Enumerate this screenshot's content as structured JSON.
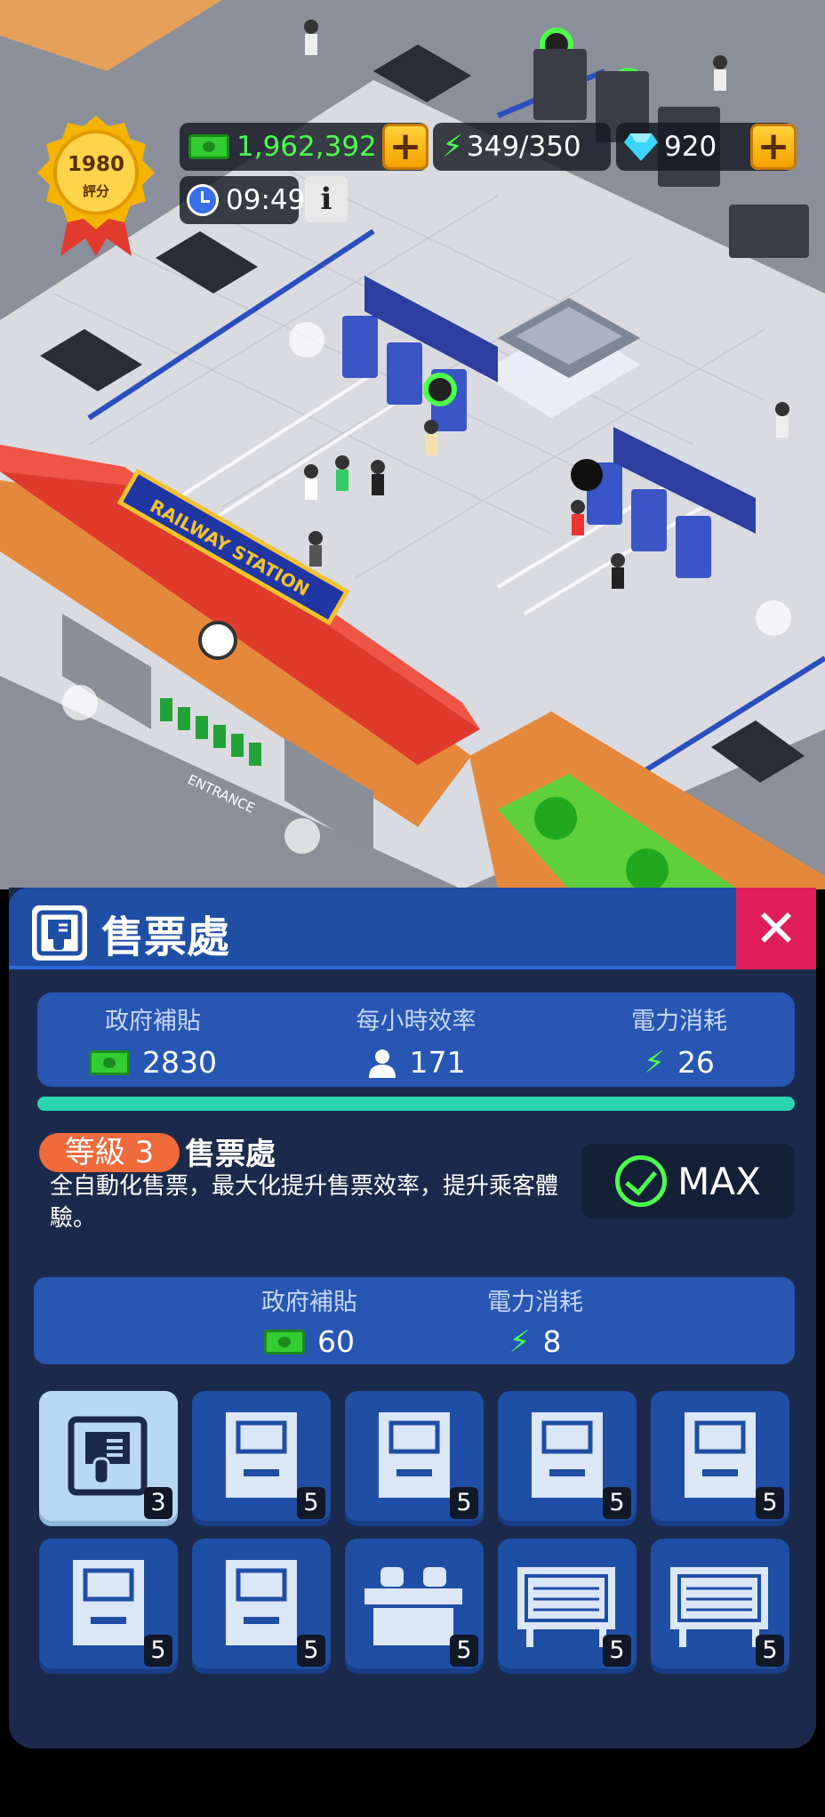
{
  "hud": {
    "rating": {
      "value": "1980",
      "label": "評分"
    },
    "money": {
      "value": "1,962,392",
      "icon": "cash-icon"
    },
    "energy": {
      "value": "349/350",
      "icon": "lightning-icon"
    },
    "gems": {
      "value": "920",
      "icon": "diamond-icon"
    },
    "time": {
      "value": "09:49",
      "icon": "clock-icon"
    },
    "info_button": "i",
    "plus_button": "+"
  },
  "scene": {
    "station_sign": "RAILWAY STATION",
    "entrance_label": "ENTRANCE"
  },
  "panel": {
    "title": "售票處",
    "close_label": "✕",
    "stats": [
      {
        "label": "政府補貼",
        "value": "2830",
        "icon": "cash-icon"
      },
      {
        "label": "每小時效率",
        "value": "171",
        "icon": "person-icon"
      },
      {
        "label": "電力消耗",
        "value": "26",
        "icon": "lightning-icon"
      }
    ],
    "progress": 1.0,
    "level_badge": "等級 3",
    "level_name": "售票處",
    "description": "全自動化售票，最大化提升售票效率，提升乘客體驗。",
    "max_label": "MAX",
    "upgrade": [
      {
        "label": "政府補貼",
        "value": "60",
        "icon": "cash-icon"
      },
      {
        "label": "電力消耗",
        "value": "8",
        "icon": "lightning-icon"
      }
    ],
    "items": [
      {
        "icon": "ticket-office-icon",
        "count": "3",
        "selected": true
      },
      {
        "icon": "ticket-machine-icon",
        "count": "5"
      },
      {
        "icon": "ticket-machine-icon",
        "count": "5"
      },
      {
        "icon": "ticket-machine-icon",
        "count": "5"
      },
      {
        "icon": "ticket-machine-icon",
        "count": "5"
      },
      {
        "icon": "ticket-machine-icon",
        "count": "5"
      },
      {
        "icon": "ticket-machine-icon",
        "count": "5"
      },
      {
        "icon": "ticket-counter-icon",
        "count": "5"
      },
      {
        "icon": "departure-board-icon",
        "count": "5"
      },
      {
        "icon": "departure-board-icon",
        "count": "5"
      }
    ]
  },
  "colors": {
    "panel_bg": "#1b2a4b",
    "header_blue": "#1f4ea5",
    "accent_teal": "#2ad4b1",
    "close_red": "#e01e5a",
    "level_orange": "#f06a3c",
    "money_green": "#4cff4c"
  }
}
